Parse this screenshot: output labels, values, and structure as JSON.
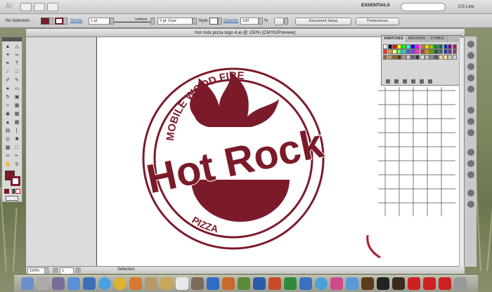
{
  "appbar": {
    "app_logo": "Ai",
    "workspace": "ESSENTIALS",
    "cs_live": "CS Live"
  },
  "control_bar": {
    "selection_state": "No Selection",
    "stroke_label": "Stroke",
    "stroke_weight": "1 pt",
    "profile": "Uniform",
    "brush": "2 pt. Oval",
    "style_label": "Style:",
    "opacity_label": "Opacity:",
    "opacity_value": "100",
    "opacity_unit": "%",
    "document_setup": "Document Setup",
    "preferences": "Preferences",
    "fill_color": "#7b1b2a"
  },
  "document": {
    "title": "hot rock pizza logo 4.ai @ 150% (CMYK/Preview)",
    "zoom": "150%",
    "artboard": "1",
    "status_tool": "Selection"
  },
  "logo": {
    "arc_text": "MOBILE WOOD FIRE",
    "main_text": "Hot Rock",
    "bottom_text": "PIZZA",
    "color": "#7b1b2a"
  },
  "swatches_panel": {
    "tabs": [
      "SWATCHES",
      "BRUSHES",
      "SYMBOL"
    ],
    "colors": [
      "#ffffff",
      "#000000",
      "#ff0000",
      "#ffff00",
      "#00ff00",
      "#00ffff",
      "#0000ff",
      "#ff00ff",
      "#ff6600",
      "#ffcc00",
      "#99cc00",
      "#009933",
      "#006666",
      "#003399",
      "#660099",
      "#cc0066",
      "#ff3333",
      "#ff9933",
      "#ffff66",
      "#66ff66",
      "#33cccc",
      "#3366ff",
      "#9933ff",
      "#ff33cc",
      "#cc3300",
      "#cc9900",
      "#669900",
      "#006633",
      "#336666",
      "#333399",
      "#663399",
      "#993366",
      "#996633",
      "#cc9966",
      "#996600",
      "#663300",
      "#999999",
      "#cccccc",
      "#666666",
      "#333333",
      "#e0e0e0",
      "#bdbdbd",
      "#8a8a8a",
      "#5a5a5a",
      "#ffd9b3",
      "#ffe699",
      "#c6e0b4",
      "#bdd7ee"
    ]
  }
}
